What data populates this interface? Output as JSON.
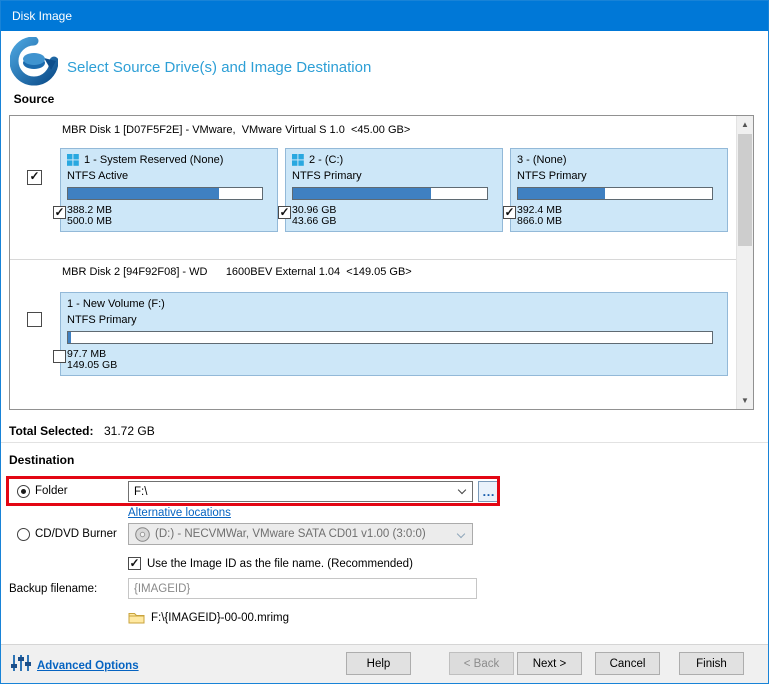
{
  "window": {
    "title": "Disk Image"
  },
  "header": {
    "title": "Select Source Drive(s) and Image Destination",
    "source_label": "Source"
  },
  "icons": {
    "scroll_up": "▲",
    "scroll_down": "▼",
    "browse": "…"
  },
  "disks": [
    {
      "header": "MBR Disk 1 [D07F5F2E] - VMware,  VMware Virtual S 1.0  <45.00 GB>",
      "partitions": [
        {
          "name": "1 - System Reserved (None)",
          "fs": "NTFS Active",
          "used": "388.2 MB",
          "size": "500.0 MB",
          "fill": "78%"
        },
        {
          "name": "2 - (C:)",
          "fs": "NTFS Primary",
          "used": "30.96 GB",
          "size": "43.66 GB",
          "fill": "71%"
        },
        {
          "name": "3 - (None)",
          "fs": "NTFS Primary",
          "used": "392.4 MB",
          "size": "866.0 MB",
          "fill": "45%"
        }
      ]
    },
    {
      "header": "MBR Disk 2 [94F92F08] - WD      1600BEV External 1.04  <149.05 GB>",
      "partitions": [
        {
          "name": "1 - New Volume (F:)",
          "fs": "NTFS Primary",
          "used": "97.7 MB",
          "size": "149.05 GB",
          "fill": "0.5%"
        }
      ]
    }
  ],
  "totals": {
    "label": "Total Selected:",
    "value": "31.72 GB"
  },
  "destination": {
    "section_label": "Destination",
    "folder_label": "Folder",
    "folder_value": "F:\\",
    "alternative_locations": "Alternative locations",
    "cd_label": "CD/DVD Burner",
    "cd_value": "(D:) - NECVMWar, VMware SATA CD01 v1.00 (3:0:0)",
    "imageid_label": "Use the Image ID as the file name.  (Recommended)",
    "backup_label": "Backup filename:",
    "backup_value": "{IMAGEID}",
    "path_preview": "F:\\{IMAGEID}-00-00.mrimg"
  },
  "footer": {
    "advanced_options": "Advanced Options",
    "help": "Help",
    "back": "< Back",
    "next": "Next >",
    "cancel": "Cancel",
    "finish": "Finish"
  }
}
